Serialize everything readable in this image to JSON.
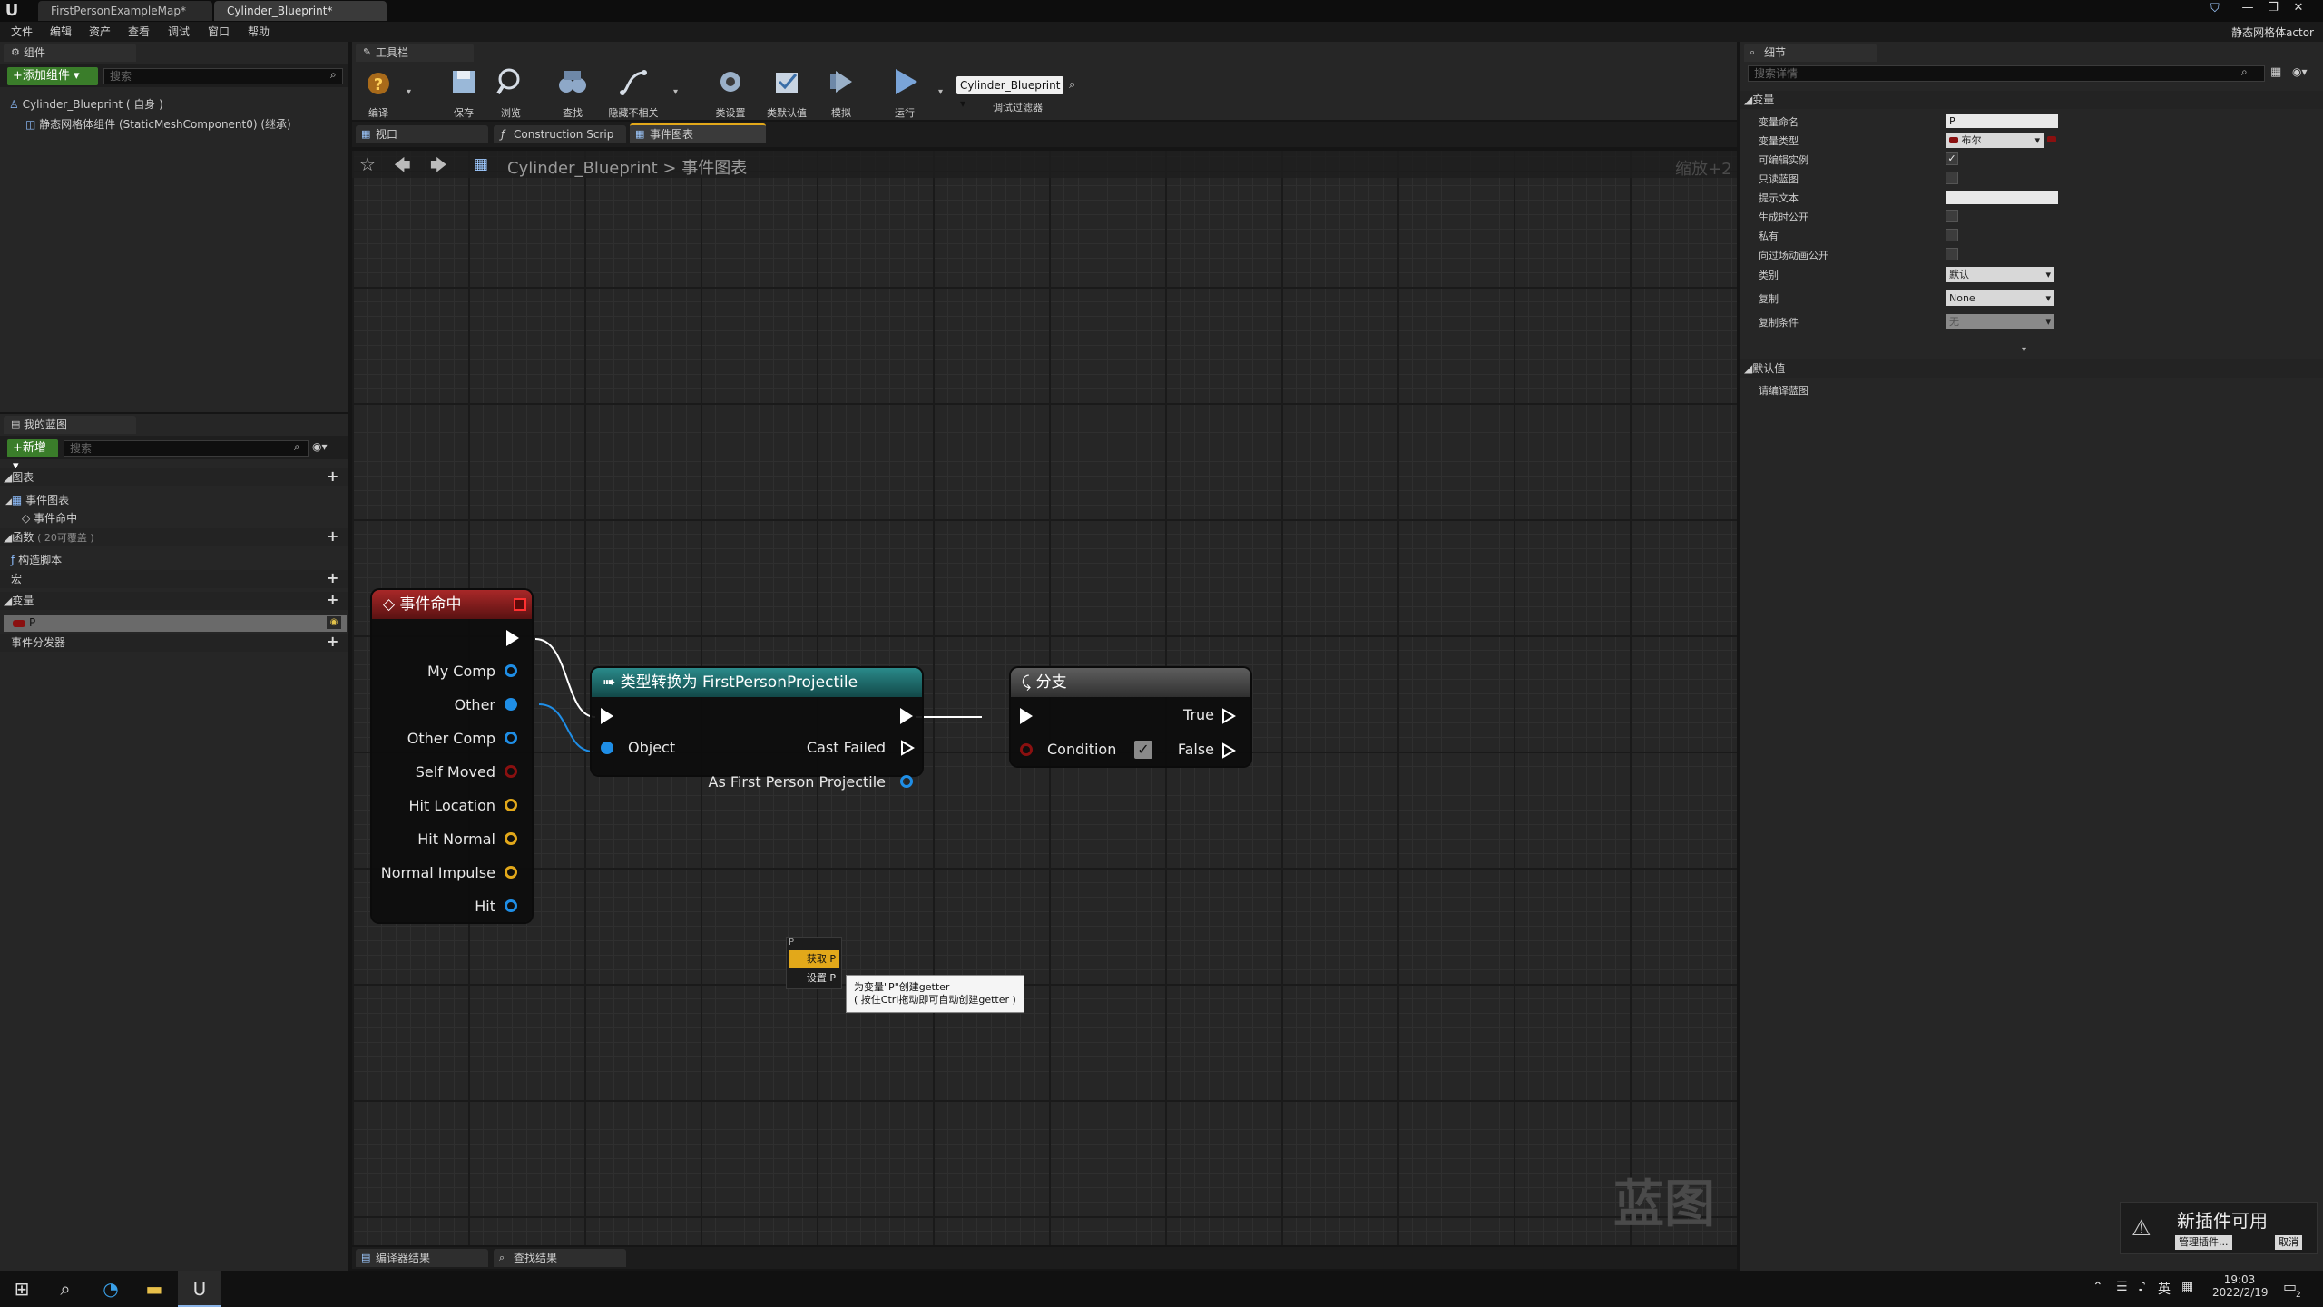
{
  "title_bar": {
    "tabs": [
      "FirstPersonExampleMap*",
      "Cylinder_Blueprint*"
    ],
    "logo": "U",
    "actor_label": "静态网格体actor",
    "min": "—",
    "max": "❐",
    "close": "✕"
  },
  "menu": [
    "文件",
    "编辑",
    "资产",
    "查看",
    "调试",
    "窗口",
    "帮助"
  ],
  "components_panel": {
    "tab": "组件",
    "add_button": "+添加组件 ▾",
    "search_placeholder": "搜索",
    "root": "Cylinder_Blueprint ( 自身 )",
    "child": "静态网格体组件 (StaticMeshComponent0) (继承)"
  },
  "my_blueprint": {
    "tab": "我的蓝图",
    "new_button": "+新增 ▾",
    "search_placeholder": "搜索",
    "sections": {
      "graphs": "图表",
      "event_graph": "事件图表",
      "event_hit": "事件命中",
      "functions": "函数",
      "functions_note": "( 20可覆盖 )",
      "construction_script": "构造脚本",
      "macros": "宏",
      "variables": "变量",
      "variable_p": "P",
      "event_dispatchers": "事件分发器"
    }
  },
  "toolbar": {
    "tab": "工具栏",
    "buttons": [
      "编译",
      "保存",
      "浏览",
      "查找",
      "隐藏不相关",
      "类设置",
      "类默认值",
      "模拟",
      "运行"
    ],
    "debug_dropdown": "Cylinder_Blueprint ▾",
    "debug_filter_label": "调试过滤器"
  },
  "editor_tabs": [
    "视口",
    "Construction Scrip",
    "事件图表"
  ],
  "breadcrumb": {
    "blueprint": "Cylinder_Blueprint",
    "separator": ">",
    "graph": "事件图表"
  },
  "zoom": "缩放+2",
  "watermark": "蓝图",
  "nodes": {
    "event_hit": {
      "title": "事件命中",
      "pins": [
        "My Comp",
        "Other",
        "Other Comp",
        "Self Moved",
        "Hit Location",
        "Hit Normal",
        "Normal Impulse",
        "Hit"
      ]
    },
    "cast": {
      "title": "类型转换为 FirstPersonProjectile",
      "object": "Object",
      "cast_failed": "Cast Failed",
      "as_output": "As First Person Projectile"
    },
    "branch": {
      "title": "分支",
      "condition": "Condition",
      "true": "True",
      "false": "False"
    },
    "context_menu": {
      "header": "P",
      "get": "获取 P",
      "set": "设置 P"
    },
    "tooltip": {
      "line1": "为变量\"P\"创建getter",
      "line2": "( 按住Ctrl拖动即可自动创建getter )"
    }
  },
  "bottom_tabs": [
    "编译器结果",
    "查找结果"
  ],
  "details": {
    "tab": "细节",
    "search_placeholder": "搜索详情",
    "section_variable": "变量",
    "fields": {
      "name_label": "变量命名",
      "name_value": "P",
      "type_label": "变量类型",
      "type_value": "布尔",
      "editable_label": "可编辑实例",
      "readonly_label": "只读蓝图",
      "tooltip_label": "提示文本",
      "expose_label": "生成时公开",
      "private_label": "私有",
      "cinematics_label": "向过场动画公开",
      "category_label": "类别",
      "category_value": "默认",
      "replication_label": "复制",
      "replication_value": "None",
      "repcond_label": "复制条件",
      "repcond_value": "无"
    },
    "section_default": "默认值",
    "compile_hint": "请编译蓝图"
  },
  "notification": {
    "title": "新插件可用",
    "manage": "管理插件...",
    "cancel": "取消"
  },
  "taskbar": {
    "lang": "英",
    "time": "19:03",
    "date": "2022/2/19",
    "notif_count": "2"
  },
  "colors": {
    "event_red": "#8a1c1c",
    "cast_teal": "#1d6b6b",
    "branch_gray": "#4a4a4a",
    "pin_blue": "#1f8ee6",
    "pin_red": "#8a1010",
    "pin_yellow": "#e2a81a",
    "get_orange": "#e2a81a"
  }
}
